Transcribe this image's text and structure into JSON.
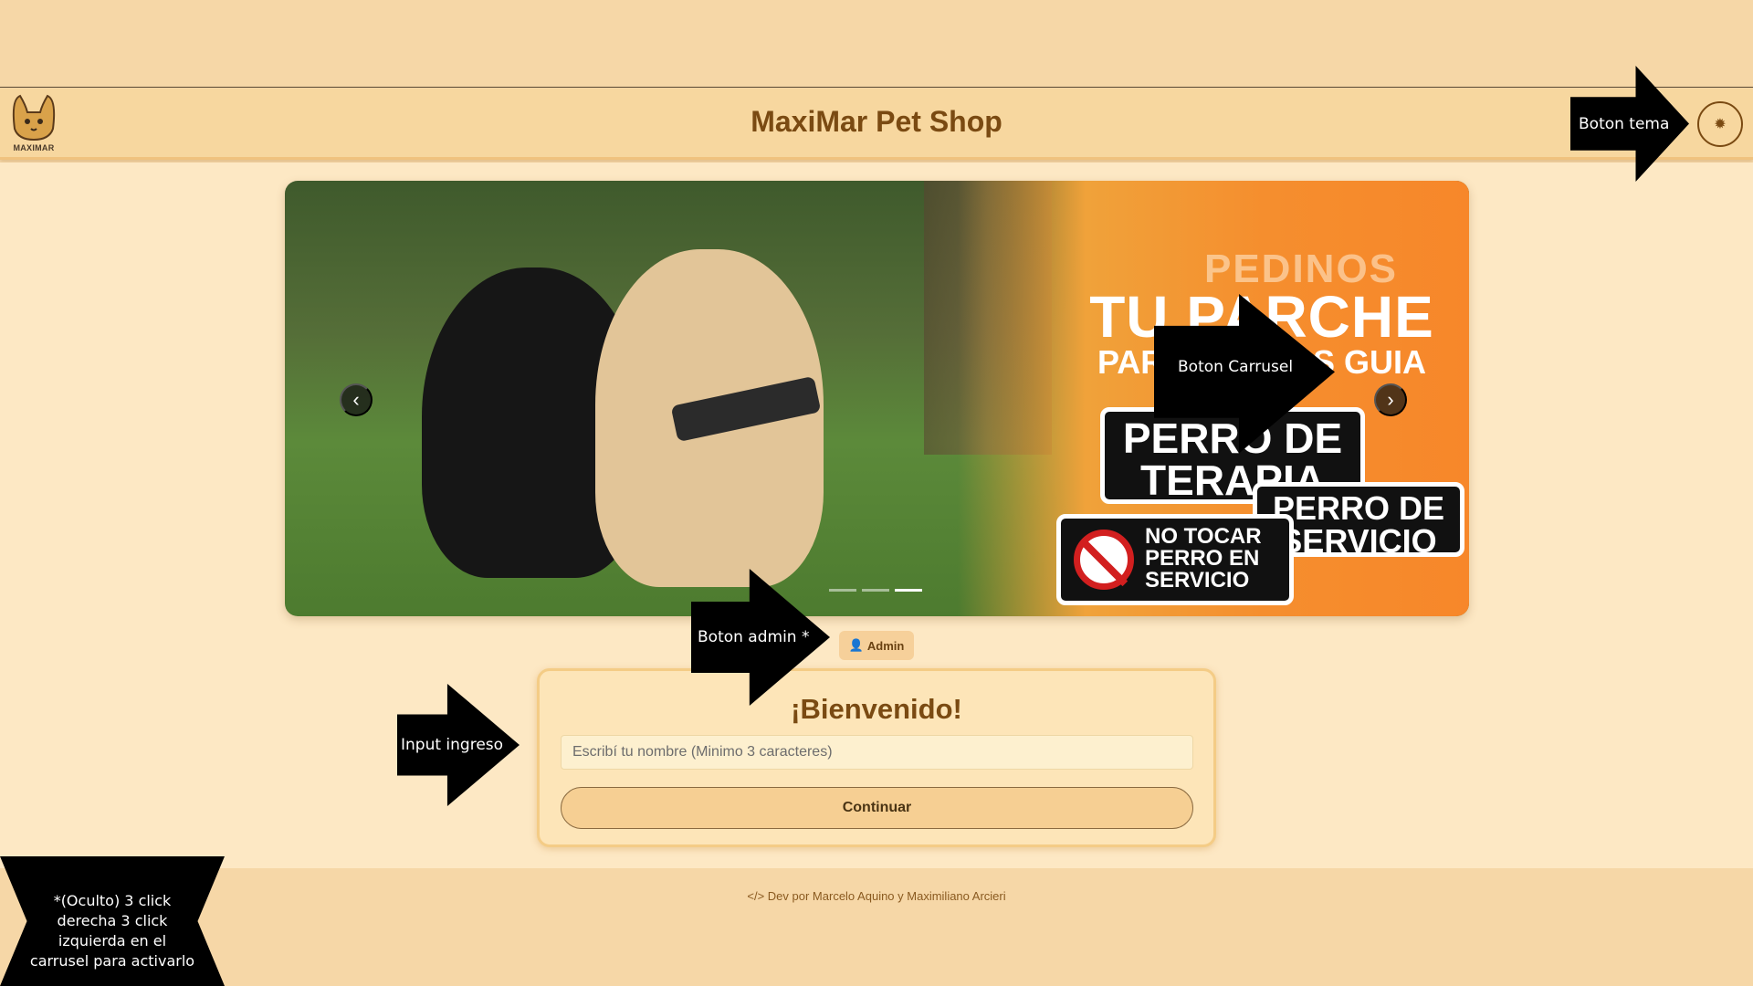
{
  "navbar": {
    "logo_text": "MAXIMAR",
    "title": "MaxiMar Pet Shop",
    "theme_icon": "sun-icon"
  },
  "carousel": {
    "promo_small": "PEDINOS",
    "promo_big": "TU PARCHE",
    "promo_mid": "PARA PERROS GUIA",
    "patch_terapia": "PERRO DE TERAPIA",
    "patch_servicio": "PERRO DE SERVICIO",
    "patch_notocar": "NO TOCAR PERRO EN SERVICIO",
    "prev_icon": "chevron-left-icon",
    "next_icon": "chevron-right-icon",
    "indicator_count": 3,
    "active_indicator": 3
  },
  "admin": {
    "label": "Admin",
    "icon": "user-gear-icon"
  },
  "welcome": {
    "title": "¡Bienvenido!",
    "input_placeholder": "Escribí tu nombre (Minimo 3 caracteres)",
    "input_value": "",
    "continue_label": "Continuar"
  },
  "footer": {
    "icon": "code-icon",
    "text": "Dev por Marcelo Aquino y Maximiliano Arcieri"
  },
  "annotations": {
    "tema": "Boton tema",
    "carrusel": "Boton Carrusel",
    "admin": "Boton admin *",
    "input": "Input ingreso",
    "note": "*(Oculto) 3 click derecha 3 click izquierda en el carrusel para activarlo"
  },
  "colors": {
    "background": "#f6d7a7",
    "main_background": "#fde8c4",
    "brand": "#7a4a12",
    "accent": "#f6cf93"
  }
}
